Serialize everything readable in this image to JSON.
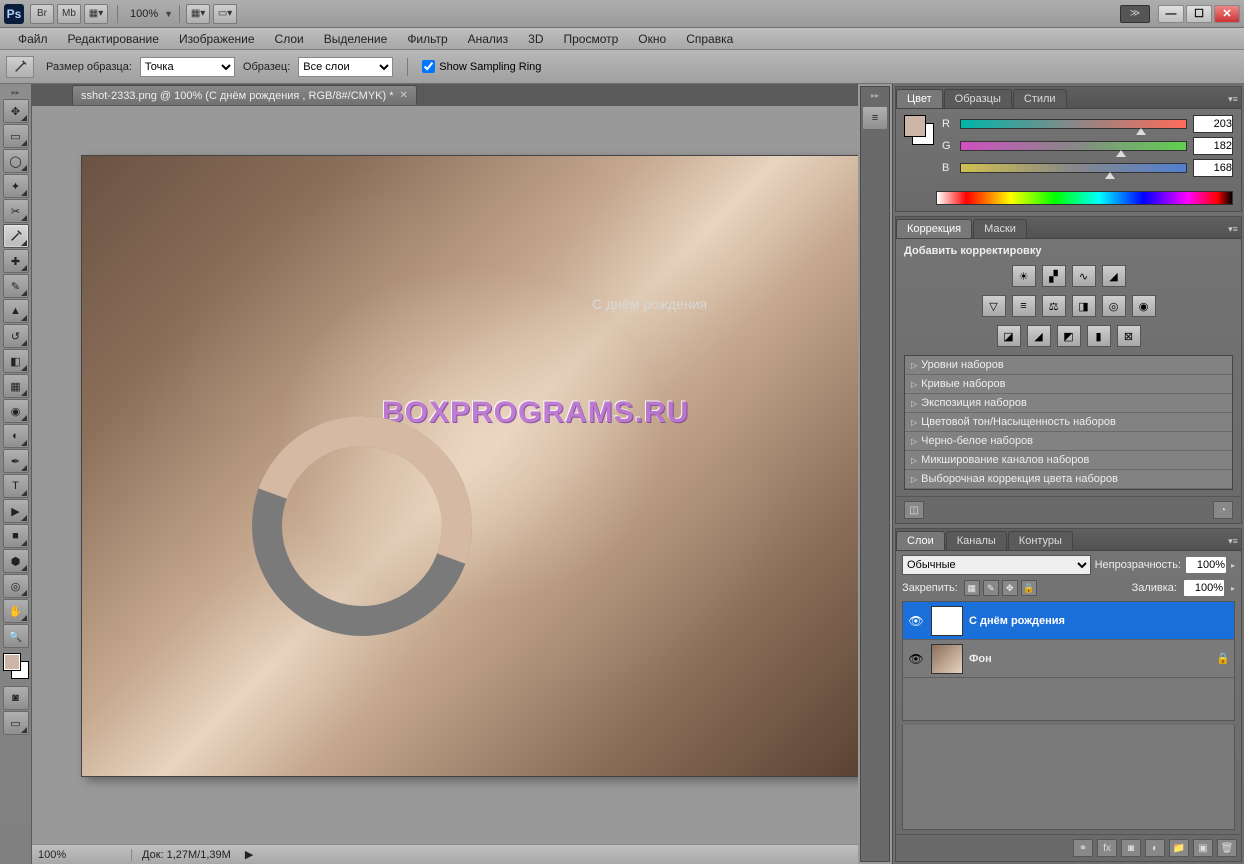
{
  "titlebar": {
    "zoom": "100%"
  },
  "menubar": {
    "items": [
      "Файл",
      "Редактирование",
      "Изображение",
      "Слои",
      "Выделение",
      "Фильтр",
      "Анализ",
      "3D",
      "Просмотр",
      "Окно",
      "Справка"
    ]
  },
  "optbar": {
    "sample_size_label": "Размер образца:",
    "sample_size_value": "Точка",
    "sample_label": "Образец:",
    "sample_value": "Все слои",
    "show_ring": "Show Sampling Ring"
  },
  "doc_tab": {
    "title": "sshot-2333.png @ 100% (С днём рождения , RGB/8#/CMYK) *"
  },
  "canvas": {
    "overlay_text": "С днём рождения",
    "watermark": "BOXPROGRAMS.RU"
  },
  "statusbar": {
    "zoom": "100%",
    "doc": "Док: 1,27M/1,39M"
  },
  "color_panel": {
    "tabs": [
      "Цвет",
      "Образцы",
      "Стили"
    ],
    "channels": {
      "r": {
        "label": "R",
        "value": "203"
      },
      "g": {
        "label": "G",
        "value": "182"
      },
      "b": {
        "label": "B",
        "value": "168"
      }
    }
  },
  "adj_panel": {
    "tabs": [
      "Коррекция",
      "Маски"
    ],
    "add_label": "Добавить корректировку",
    "presets": [
      "Уровни наборов",
      "Кривые наборов",
      "Экспозиция наборов",
      "Цветовой тон/Насыщенность наборов",
      "Черно-белое наборов",
      "Микширование каналов наборов",
      "Выборочная коррекция цвета наборов"
    ]
  },
  "layers_panel": {
    "tabs": [
      "Слои",
      "Каналы",
      "Контуры"
    ],
    "blend_mode": "Обычные",
    "opacity_label": "Непрозрачность:",
    "opacity_value": "100%",
    "lock_label": "Закрепить:",
    "fill_label": "Заливка:",
    "fill_value": "100%",
    "layers": [
      {
        "name": "С днём рождения",
        "type": "T",
        "selected": true,
        "locked": false
      },
      {
        "name": "Фон",
        "type": "img",
        "selected": false,
        "locked": true
      }
    ]
  }
}
